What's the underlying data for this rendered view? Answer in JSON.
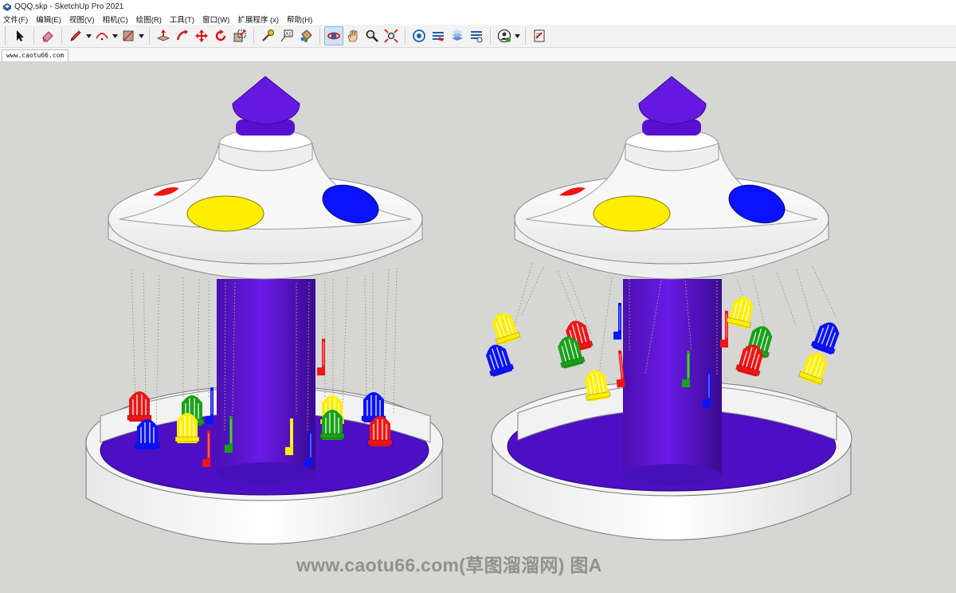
{
  "window": {
    "title": "QQQ.skp - SketchUp Pro 2021"
  },
  "menu": [
    "文件(F)",
    "编辑(E)",
    "视图(V)",
    "相机(C)",
    "绘图(R)",
    "工具(T)",
    "窗口(W)",
    "扩展程序 (x)",
    "帮助(H)"
  ],
  "toolbar": {
    "groups": [
      [
        "select-tool",
        "eraser-tool",
        "line-tool",
        "arc-tool",
        "shape-tool"
      ],
      [
        "push-pull-tool",
        "follow-me-tool",
        "move-tool",
        "rotate-tool",
        "scale-tool"
      ],
      [
        "tape-measure-tool",
        "text-tool",
        "paint-bucket-tool"
      ],
      [
        "orbit-tool",
        "pan-tool",
        "zoom-tool",
        "zoom-extents-tool"
      ],
      [
        "3d-warehouse",
        "extension-warehouse",
        "layout",
        "extension-manager"
      ],
      [
        "account"
      ],
      [
        "model-info"
      ]
    ],
    "active_tool": "orbit-tool"
  },
  "scene_tab": {
    "label": "www.caotu66.com"
  },
  "viewport": {
    "background": "#d6d6d4",
    "model": "swing-carousel",
    "colors": {
      "purple": "#5a0fd0",
      "canopy": "#ffffff",
      "yellow": "#ffee00",
      "blue": "#0a12ff",
      "red": "#ee1515",
      "green": "#1aa01a"
    }
  },
  "watermark": "www.caotu66.com(草图溜溜网) 图A"
}
